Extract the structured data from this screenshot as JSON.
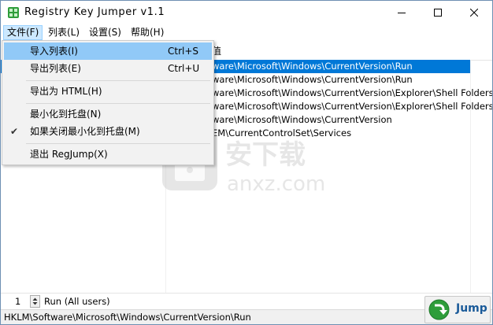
{
  "window": {
    "title": "Registry Key Jumper v1.1"
  },
  "menubar": {
    "items": [
      {
        "label": "文件(F)"
      },
      {
        "label": "列表(L)"
      },
      {
        "label": "设置(S)"
      },
      {
        "label": "帮助(H)"
      }
    ]
  },
  "file_menu": {
    "items": [
      {
        "label": "导入列表(I)",
        "shortcut": "Ctrl+S"
      },
      {
        "label": "导出列表(E)",
        "shortcut": "Ctrl+U"
      },
      {
        "label": "导出为 HTML(H)"
      },
      {
        "label": "最小化到托盘(N)"
      },
      {
        "label": "如果关闭最小化到托盘(M)",
        "checked": true
      },
      {
        "label": "退出 RegJump(X)"
      }
    ]
  },
  "list": {
    "column_header_fragment": "值",
    "rows": [
      "ware\\Microsoft\\Windows\\CurrentVersion\\Run",
      "ware\\Microsoft\\Windows\\CurrentVersion\\Run",
      "ware\\Microsoft\\Windows\\CurrentVersion\\Explorer\\Shell Folders",
      "ware\\Microsoft\\Windows\\CurrentVersion\\Explorer\\Shell Folders",
      "ware\\Microsoft\\Windows\\CurrentVersion",
      "EM\\CurrentControlSet\\Services"
    ],
    "selected_index": 0
  },
  "bottom": {
    "spin_value": "1",
    "spin_label": "Run (All users)",
    "jump_label": "Jump"
  },
  "status": {
    "path": "HKLM\\Software\\Microsoft\\Windows\\CurrentVersion\\Run"
  },
  "watermark": {
    "text_cn": "安下载",
    "text_en": "anxz.com"
  },
  "colors": {
    "selection": "#0078d7",
    "menu_highlight": "#91c9f7",
    "jump_text": "#1a5a99",
    "icon_green": "#2e9d3a"
  }
}
